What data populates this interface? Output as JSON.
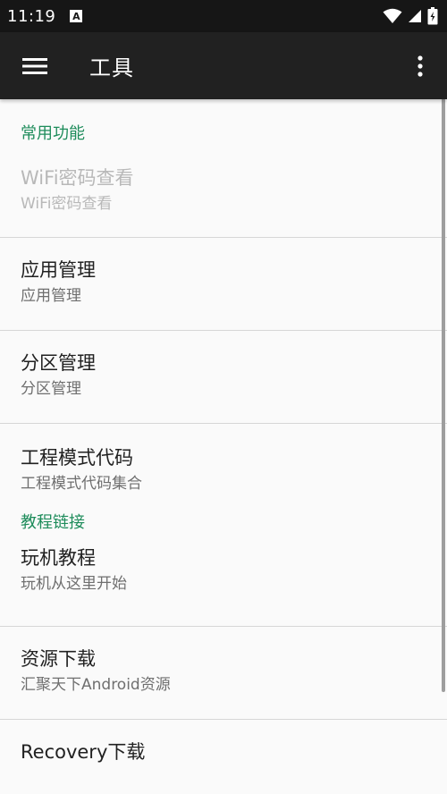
{
  "status_bar": {
    "time": "11:19",
    "notification_icon": "A"
  },
  "app_bar": {
    "title": "工具"
  },
  "sections": [
    {
      "header": "常用功能",
      "items": [
        {
          "title": "WiFi密码查看",
          "subtitle": "WiFi密码查看",
          "enabled": false
        },
        {
          "title": "应用管理",
          "subtitle": "应用管理",
          "enabled": true
        },
        {
          "title": "分区管理",
          "subtitle": "分区管理",
          "enabled": true
        },
        {
          "title": "工程模式代码",
          "subtitle": "工程模式代码集合",
          "enabled": true
        }
      ]
    },
    {
      "header": "教程链接",
      "items": [
        {
          "title": "玩机教程",
          "subtitle": "玩机从这里开始",
          "enabled": true
        },
        {
          "title": "资源下载",
          "subtitle": "汇聚天下Android资源",
          "enabled": true
        },
        {
          "title": "Recovery下载",
          "subtitle": "",
          "enabled": true
        }
      ]
    }
  ],
  "colors": {
    "accent": "#1e8c5b",
    "app_bar": "#212121",
    "status_bar": "#161616"
  }
}
